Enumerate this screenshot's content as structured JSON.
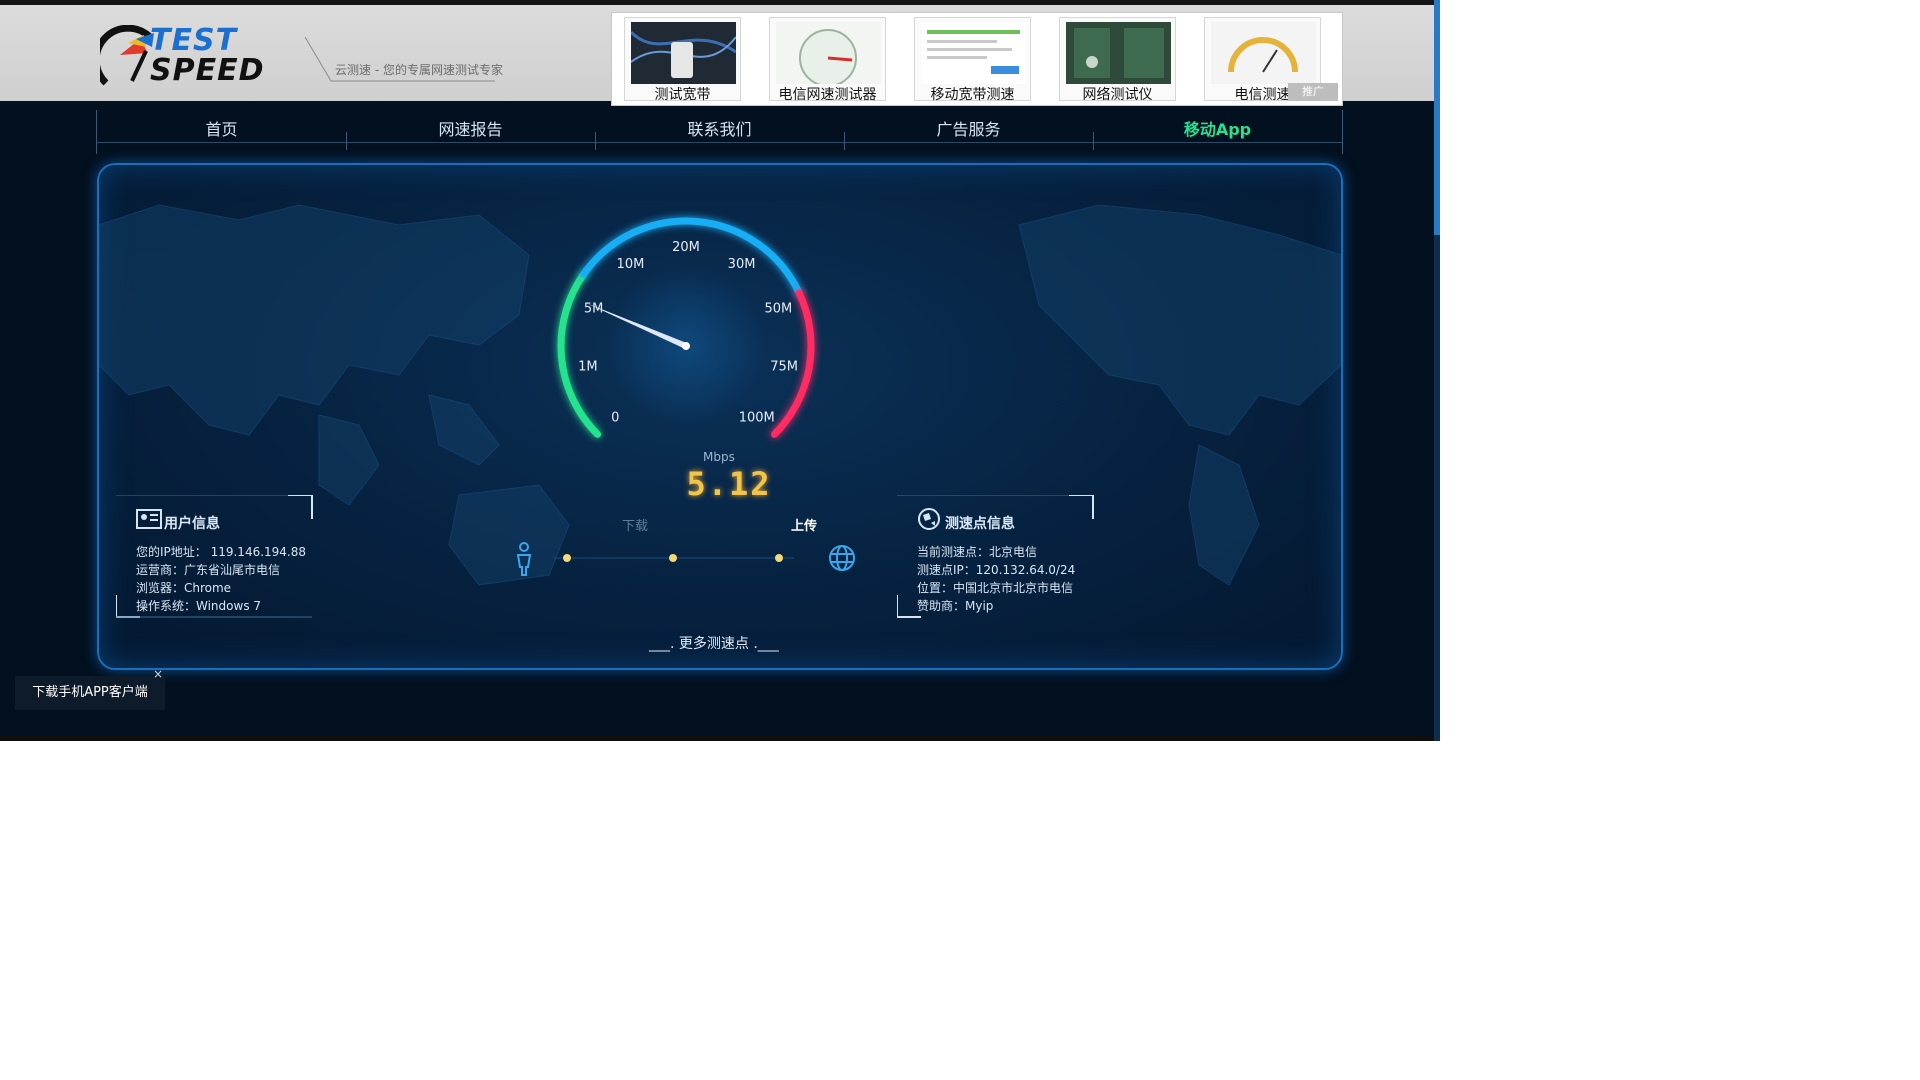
{
  "brand": {
    "logo_top": "TEST",
    "logo_bottom": "SPEED",
    "tagline": "云测速 - 您的专属网速测试专家"
  },
  "ads": [
    {
      "label": "测试宽带"
    },
    {
      "label": "电信网速测试器"
    },
    {
      "label": "移动宽带测速"
    },
    {
      "label": "网络测试仪"
    },
    {
      "label": "电信测速"
    }
  ],
  "ads_badge": "推广",
  "nav": {
    "items": [
      "首页",
      "网速报告",
      "联系我们",
      "广告服务",
      "移动App"
    ],
    "active_index": 4
  },
  "gauge": {
    "ticks": [
      "0",
      "1M",
      "5M",
      "10M",
      "20M",
      "30M",
      "50M",
      "75M",
      "100M"
    ],
    "unit": "Mbps",
    "value_display": "5.12",
    "value_mbps": 5.12
  },
  "tabs": {
    "download": "下载",
    "upload": "上传"
  },
  "user_info": {
    "title": "用户信息",
    "ip": "您的IP地址： 119.146.194.88",
    "isp": "运营商：广东省汕尾市电信",
    "browser": "浏览器：Chrome",
    "os": "操作系统：Windows 7"
  },
  "node_info": {
    "title": "测速点信息",
    "current": "当前测速点：北京电信",
    "ip": "测速点IP：120.132.64.0/24",
    "location": "位置：中国北京市北京市电信",
    "sponsor": "赞助商：Myip"
  },
  "more_nodes": "___. 更多测速点 .___",
  "app_download": "下载手机APP客户端",
  "app_close": "×",
  "colors": {
    "accent_green": "#25e28f",
    "gauge_cyan": "#18aef5",
    "gauge_red": "#ff2b63",
    "digit_gold": "#f1c54a",
    "panel_border": "#1e6db8"
  }
}
